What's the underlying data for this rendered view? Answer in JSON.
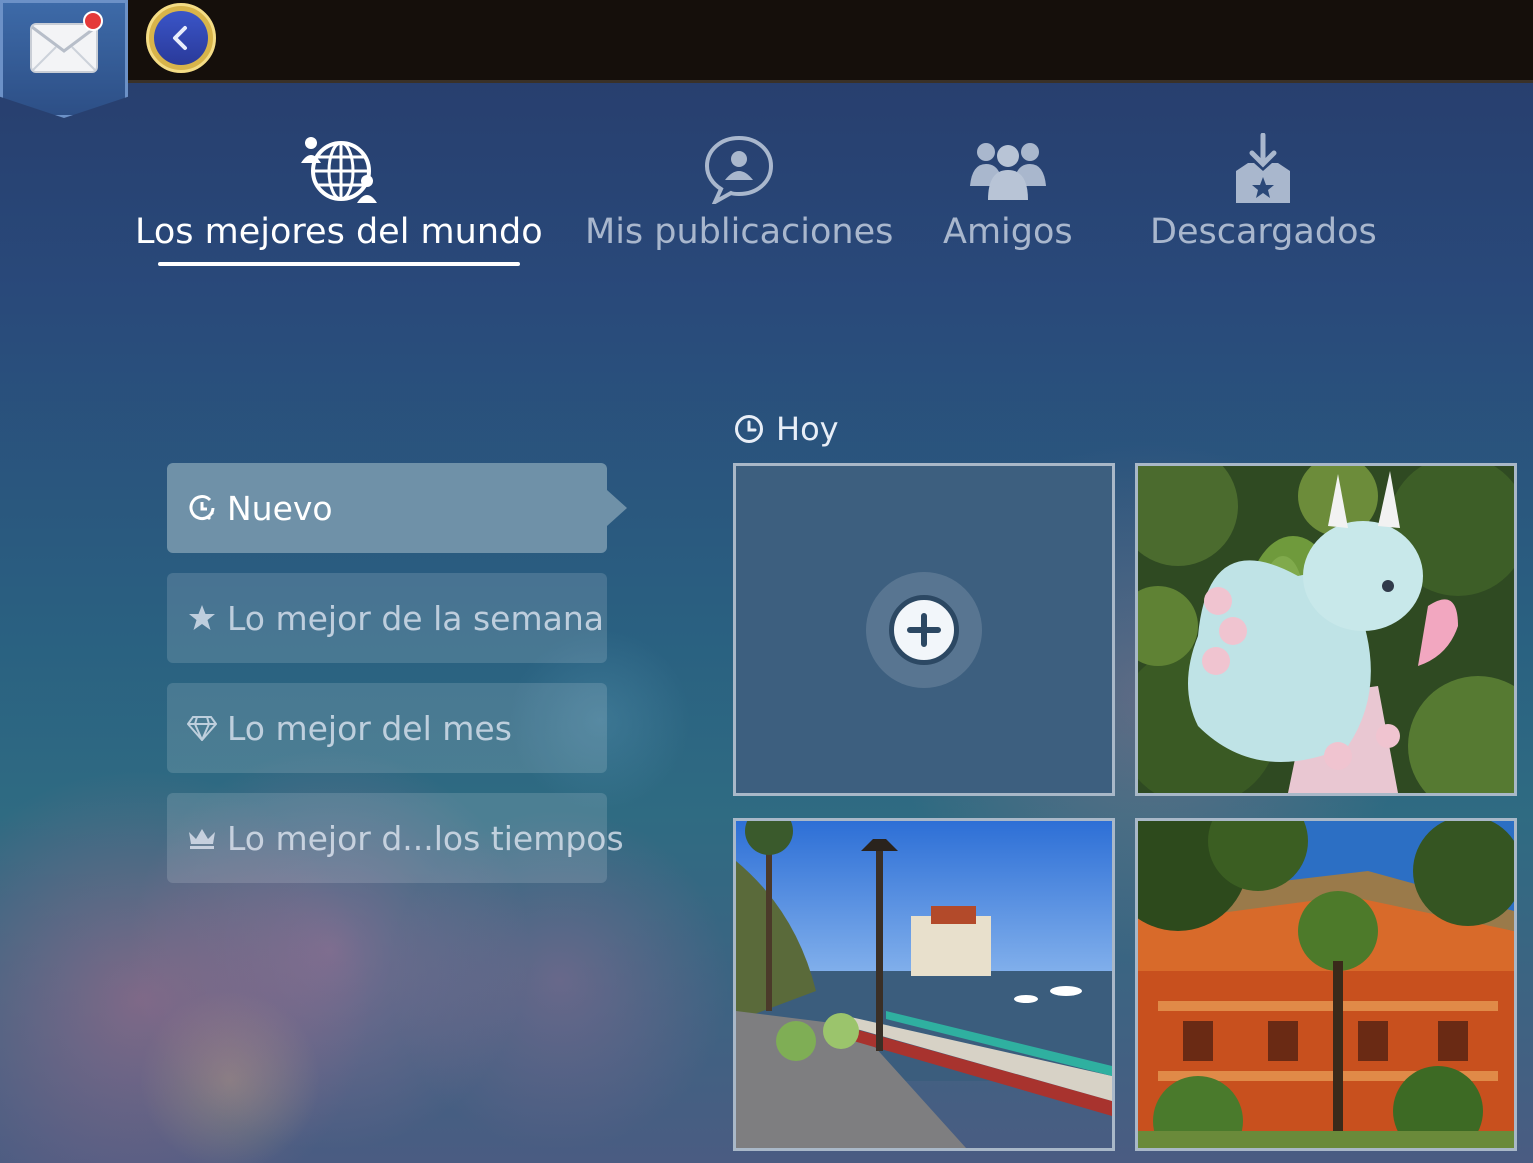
{
  "topbar": {
    "has_notification": true
  },
  "tabs": [
    {
      "label": "Los mejores del mundo",
      "active": true,
      "icon": "globe-users-icon"
    },
    {
      "label": "Mis publicaciones",
      "active": false,
      "icon": "user-speech-bubble-icon"
    },
    {
      "label": "Amigos",
      "active": false,
      "icon": "friends-group-icon"
    },
    {
      "label": "Descargados",
      "active": false,
      "icon": "download-tray-star-icon"
    }
  ],
  "filters": [
    {
      "label": "Nuevo",
      "active": true,
      "icon": "clock-refresh-icon"
    },
    {
      "label": "Lo mejor de la semana",
      "active": false,
      "icon": "star-icon"
    },
    {
      "label": "Lo mejor del mes",
      "active": false,
      "icon": "diamond-icon"
    },
    {
      "label": "Lo mejor d...los tiempos",
      "active": false,
      "icon": "crown-icon"
    }
  ],
  "gallery": {
    "section_title": "Hoy",
    "tiles": [
      {
        "type": "add",
        "icon": "plus-icon"
      },
      {
        "type": "photo",
        "subject": "dragon-figurine"
      },
      {
        "type": "photo",
        "subject": "harbor-promenade"
      },
      {
        "type": "photo",
        "subject": "orange-building"
      }
    ]
  },
  "colors": {
    "accent_active_filter": "#6f91a8",
    "topbar": "#150f0b",
    "back_button_gold": "#d8b44a"
  }
}
